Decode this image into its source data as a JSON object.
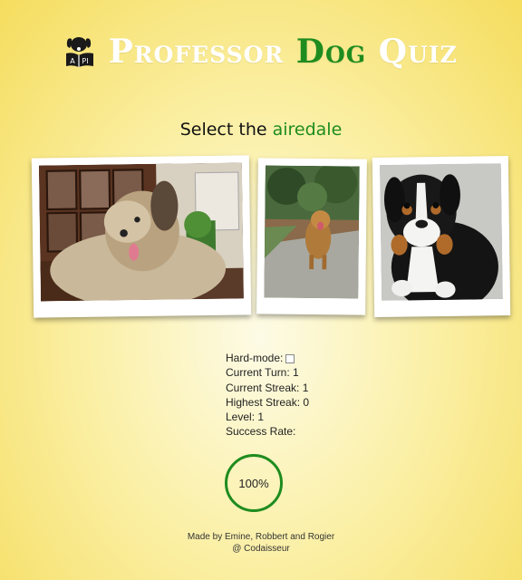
{
  "app": {
    "title_part1": "Professor ",
    "title_part2": "Dog",
    "title_part3": " Quiz",
    "logo_icon": "dog-book-icon",
    "accent_color": "#1f8c1f"
  },
  "question": {
    "prompt": "Select the ",
    "breed": "airedale"
  },
  "photos": [
    {
      "name": "briard-photo",
      "alt": "Shaggy tan dog indoors"
    },
    {
      "name": "retriever-photo",
      "alt": "Golden dog running on path"
    },
    {
      "name": "bernese-puppy-photo",
      "alt": "Tricolor puppy"
    }
  ],
  "stats": {
    "hard_mode_label": "Hard-mode:",
    "hard_mode_checked": false,
    "current_turn_label": "Current Turn:",
    "current_turn": "1",
    "current_streak_label": "Current Streak:",
    "current_streak": "1",
    "highest_streak_label": "Highest Streak:",
    "highest_streak": "0",
    "level_label": "Level:",
    "level": "1",
    "success_rate_label": "Success Rate:"
  },
  "success_rate": "100%",
  "footer": {
    "line1": "Made by Emine, Robbert and Rogier",
    "line2": "@ Codaisseur"
  }
}
